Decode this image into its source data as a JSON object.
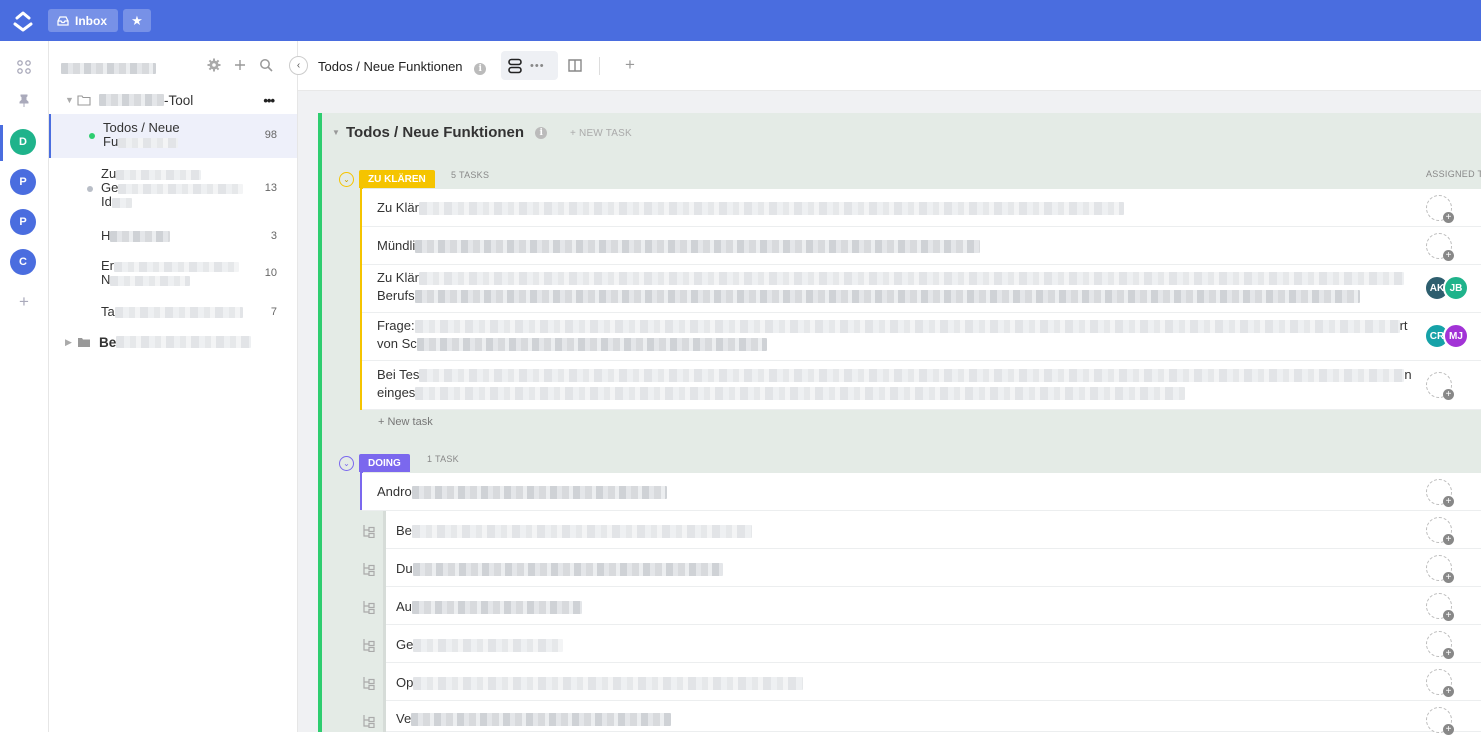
{
  "topbar": {
    "inbox_label": "Inbox",
    "accent": "#4a6ddf"
  },
  "rail": {
    "spaces": [
      {
        "letter": "D",
        "color": "#1fb38b"
      },
      {
        "letter": "P",
        "color": "#4a6ddf"
      },
      {
        "letter": "P",
        "color": "#4a6ddf"
      },
      {
        "letter": "C",
        "color": "#4a6ddf"
      }
    ],
    "add_label": "+"
  },
  "sidebar": {
    "folder_name_suffix": "-Tool",
    "folder_menu": "•••",
    "lists": [
      {
        "line1": "Todos / Neue",
        "line2": "Fu",
        "count": "98",
        "active": true,
        "dot": "#2ecd6f"
      },
      {
        "line1": "Zu",
        "line2": "Ge",
        "line3": "Id",
        "count": "13",
        "active": false,
        "dot": "#b9bec7"
      },
      {
        "line1": "H",
        "count": "3",
        "active": false
      },
      {
        "line1": "Er",
        "line2": "N",
        "count": "10",
        "active": false
      },
      {
        "line1": "Ta",
        "count": "7",
        "active": false
      }
    ],
    "folder2_prefix": "Be"
  },
  "header": {
    "breadcrumb": "Todos / Neue Funktionen",
    "add_view": "+",
    "more": "•••"
  },
  "board": {
    "title": "Todos / Neue Funktionen",
    "new_task_top": "+ NEW TASK",
    "assigned_header": "ASSIGNED TO",
    "groups": [
      {
        "status": "ZU KLÄREN",
        "color": "#f5c400",
        "count_label": "5 TASKS",
        "tasks": [
          {
            "line1": "Zu Klär",
            "avatars": []
          },
          {
            "line1": "Mündli",
            "avatars": []
          },
          {
            "line1": "Zu Klär",
            "line2": "Berufs",
            "avatars": [
              {
                "initials": "AK",
                "color": "#2e5e6e"
              },
              {
                "initials": "JB",
                "color": "#1fb38b"
              }
            ]
          },
          {
            "line1": "Frage:",
            "line1_end": "rt",
            "line2": "von Sc",
            "avatars": [
              {
                "initials": "CR",
                "color": "#16a2a8"
              },
              {
                "initials": "MJ",
                "color": "#a233d6"
              }
            ]
          },
          {
            "line1": "Bei Tes",
            "line1_end": "n",
            "line2": "einges",
            "avatars": []
          }
        ],
        "new_task": "+ New task"
      },
      {
        "status": "DOING",
        "color": "#7b68ee",
        "count_label": "1 TASK",
        "tasks": [
          {
            "line1": "Andro",
            "avatars": []
          }
        ],
        "subtasks": [
          {
            "prefix": "Be"
          },
          {
            "prefix": "Du"
          },
          {
            "prefix": "Au"
          },
          {
            "prefix": "Ge"
          },
          {
            "prefix": "Op"
          },
          {
            "prefix": "Ve"
          }
        ]
      }
    ]
  }
}
